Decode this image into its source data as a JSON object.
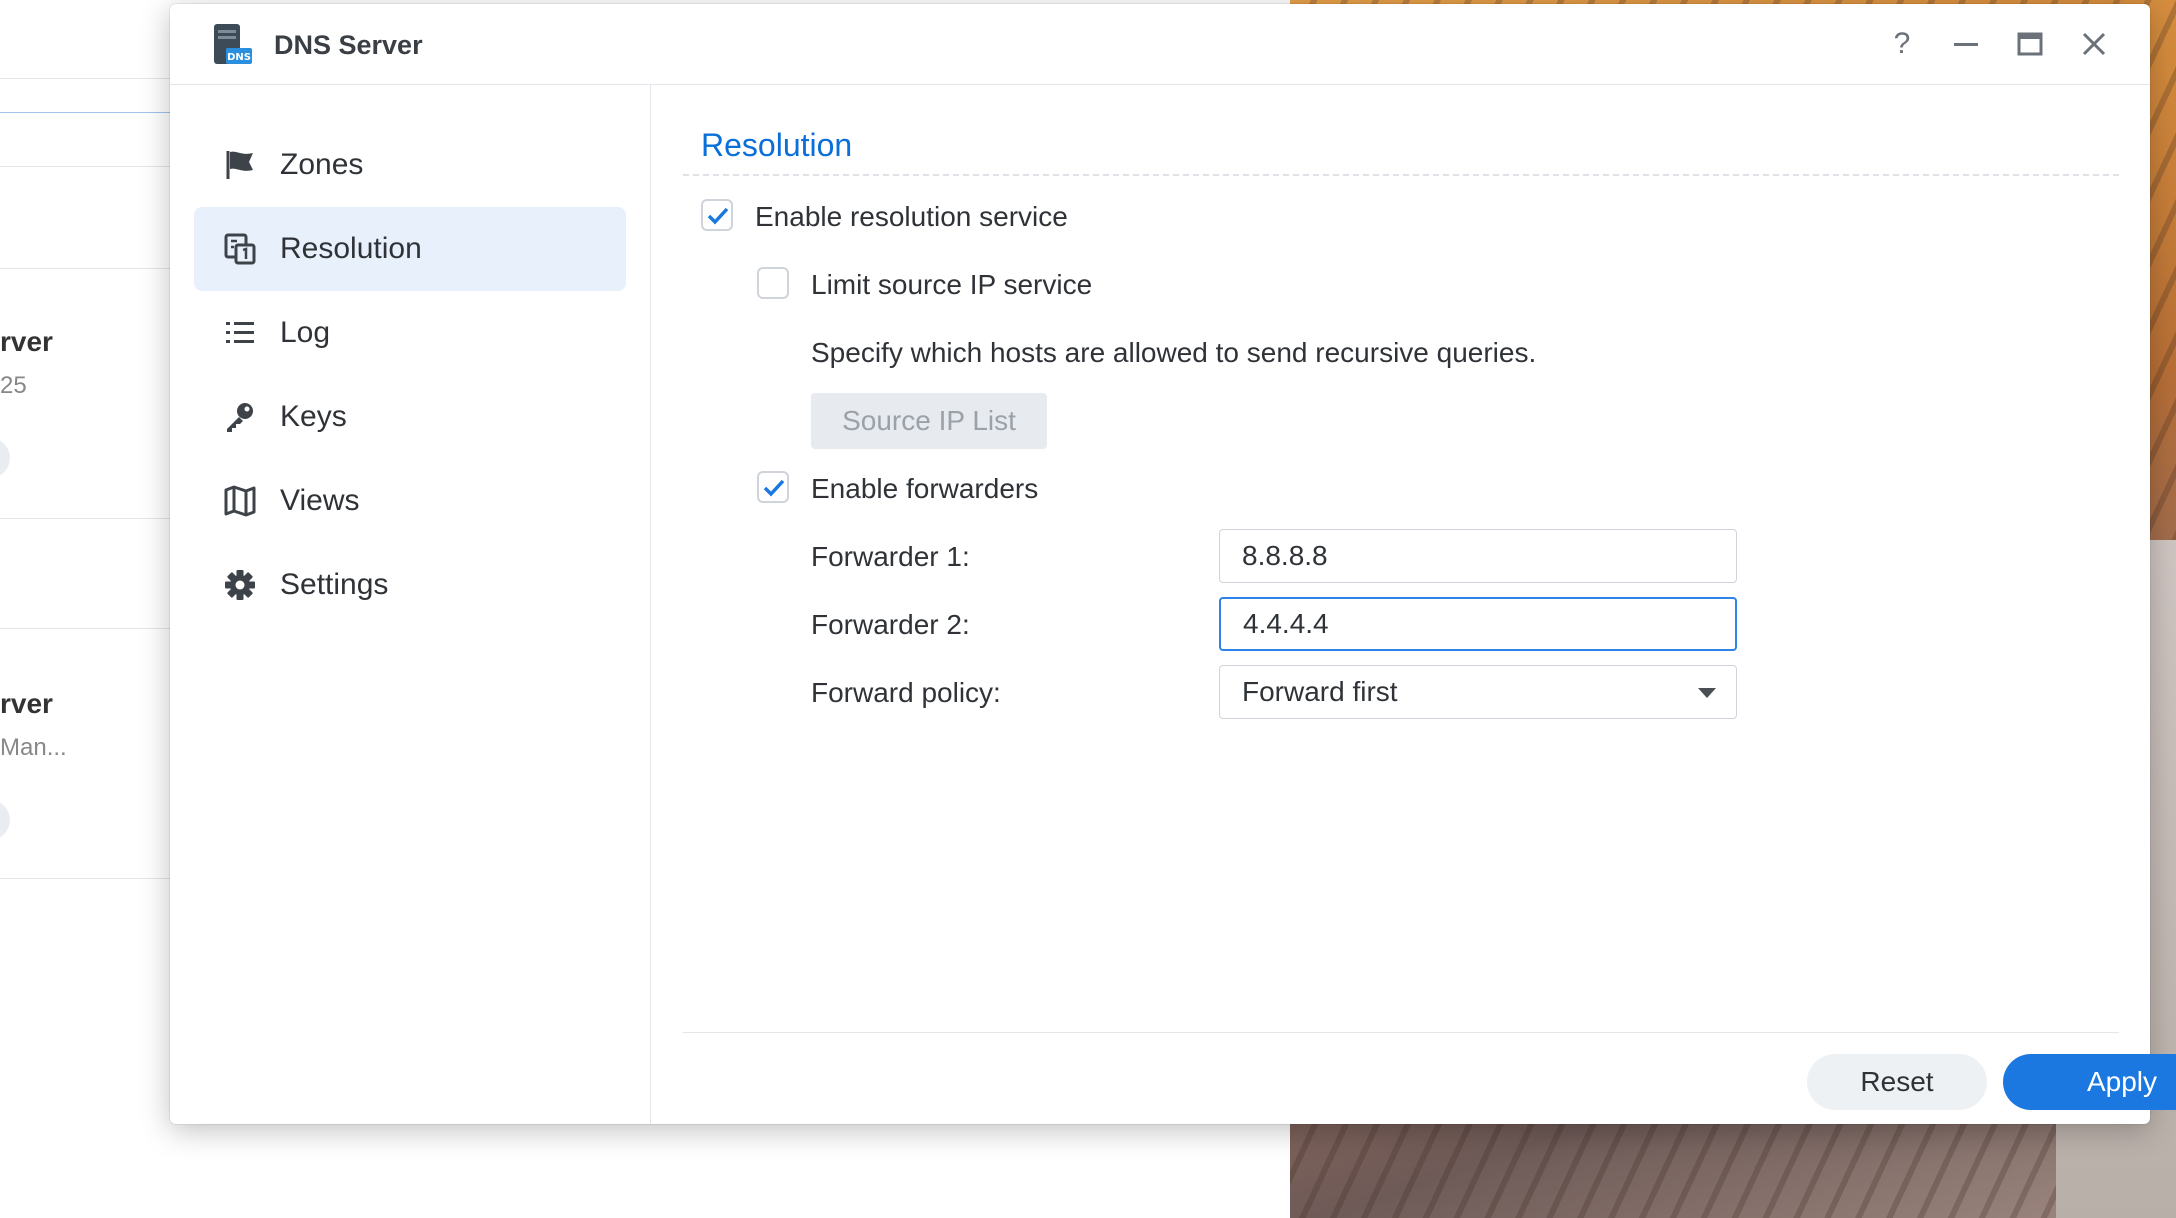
{
  "background_app": {
    "items": [
      {
        "title": "rver",
        "subtitle": "25"
      },
      {
        "title": "rver",
        "subtitle": "Man..."
      }
    ]
  },
  "window": {
    "title": "DNS Server",
    "app_icon_text": "DNS",
    "controls": {
      "help": "?",
      "minimize": "—",
      "maximize": "▭",
      "close": "✕"
    }
  },
  "sidebar": {
    "items": [
      {
        "label": "Zones",
        "icon": "flag-icon"
      },
      {
        "label": "Resolution",
        "icon": "resolution-icon",
        "active": true
      },
      {
        "label": "Log",
        "icon": "list-icon"
      },
      {
        "label": "Keys",
        "icon": "key-icon"
      },
      {
        "label": "Views",
        "icon": "map-icon"
      },
      {
        "label": "Settings",
        "icon": "gear-icon"
      }
    ]
  },
  "resolution": {
    "section_title": "Resolution",
    "enable_resolution": {
      "label": "Enable resolution service",
      "checked": true
    },
    "limit_source_ip": {
      "label": "Limit source IP service",
      "checked": false
    },
    "description": "Specify which hosts are allowed to send recursive queries.",
    "source_ip_button": "Source IP List",
    "enable_forwarders": {
      "label": "Enable forwarders",
      "checked": true
    },
    "forwarder1": {
      "label": "Forwarder 1:",
      "value": "8.8.8.8"
    },
    "forwarder2": {
      "label": "Forwarder 2:",
      "value": "4.4.4.4"
    },
    "forward_policy": {
      "label": "Forward policy:",
      "value": "Forward first"
    }
  },
  "footer": {
    "reset": "Reset",
    "apply": "Apply"
  },
  "colors": {
    "accent": "#1a78e0",
    "title_blue": "#0a6fd8",
    "active_bg": "#e8f0fb"
  }
}
